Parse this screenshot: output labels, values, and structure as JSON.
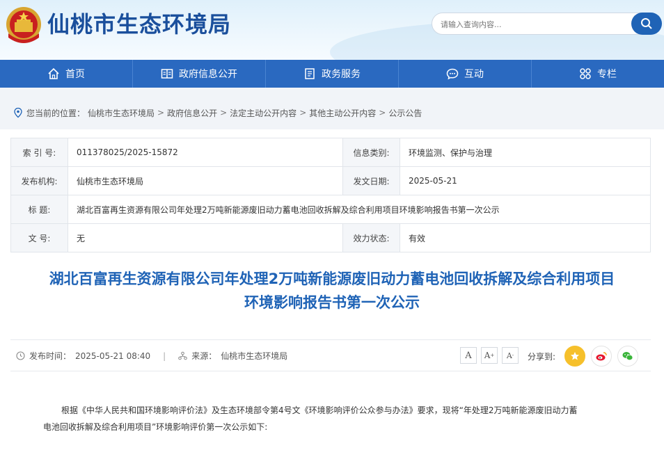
{
  "site": {
    "title": "仙桃市生态环境局",
    "emblem_icon": "national-emblem"
  },
  "search": {
    "placeholder": "请输入查询内容..."
  },
  "nav": [
    {
      "label": "首页",
      "icon": "home-icon"
    },
    {
      "label": "政府信息公开",
      "icon": "info-icon"
    },
    {
      "label": "政务服务",
      "icon": "service-icon"
    },
    {
      "label": "互动",
      "icon": "chat-icon"
    },
    {
      "label": "专栏",
      "icon": "grid-icon"
    }
  ],
  "breadcrumb": {
    "prefix": "您当前的位置：",
    "items": [
      "仙桃市生态环境局",
      "政府信息公开",
      "法定主动公开内容",
      "其他主动公开内容",
      "公示公告"
    ],
    "sep": ">"
  },
  "meta": {
    "index_label": "索 引 号:",
    "index_value": "011378025/2025-15872",
    "category_label": "信息类别:",
    "category_value": "环境监测、保护与治理",
    "org_label": "发布机构:",
    "org_value": "仙桃市生态环境局",
    "date_label": "发文日期:",
    "date_value": "2025-05-21",
    "title_label": "标      题:",
    "title_value": "湖北百富再生资源有限公司年处理2万吨新能源废旧动力蓄电池回收拆解及综合利用项目环境影响报告书第一次公示",
    "docno_label": "文      号:",
    "docno_value": "无",
    "status_label": "效力状态:",
    "status_value": "有效"
  },
  "article": {
    "title_line1": "湖北百富再生资源有限公司年处理2万吨新能源废旧动力蓄电池回收拆解及综合利用项目",
    "title_line2": "环境影响报告书第一次公示",
    "publish_label": "发布时间：",
    "publish_time": "2025-05-21 08:40",
    "source_label": "来源：",
    "source": "仙桃市生态环境局",
    "font_large": "A",
    "font_medium": "A",
    "font_small": "A",
    "share_label": "分享到:",
    "body_line1": "根据《中华人民共和国环境影响评价法》及生态环境部令第4号文《环境影响评价公众参与办法》要求，现将“年处理2万吨新能源废旧动力蓄",
    "body_line2": "电池回收拆解及综合利用项目”环境影响评价第一次公示如下:"
  },
  "colors": {
    "brand": "#1f63b6",
    "nav": "#2a69c0",
    "title": "#1a4f9c"
  }
}
